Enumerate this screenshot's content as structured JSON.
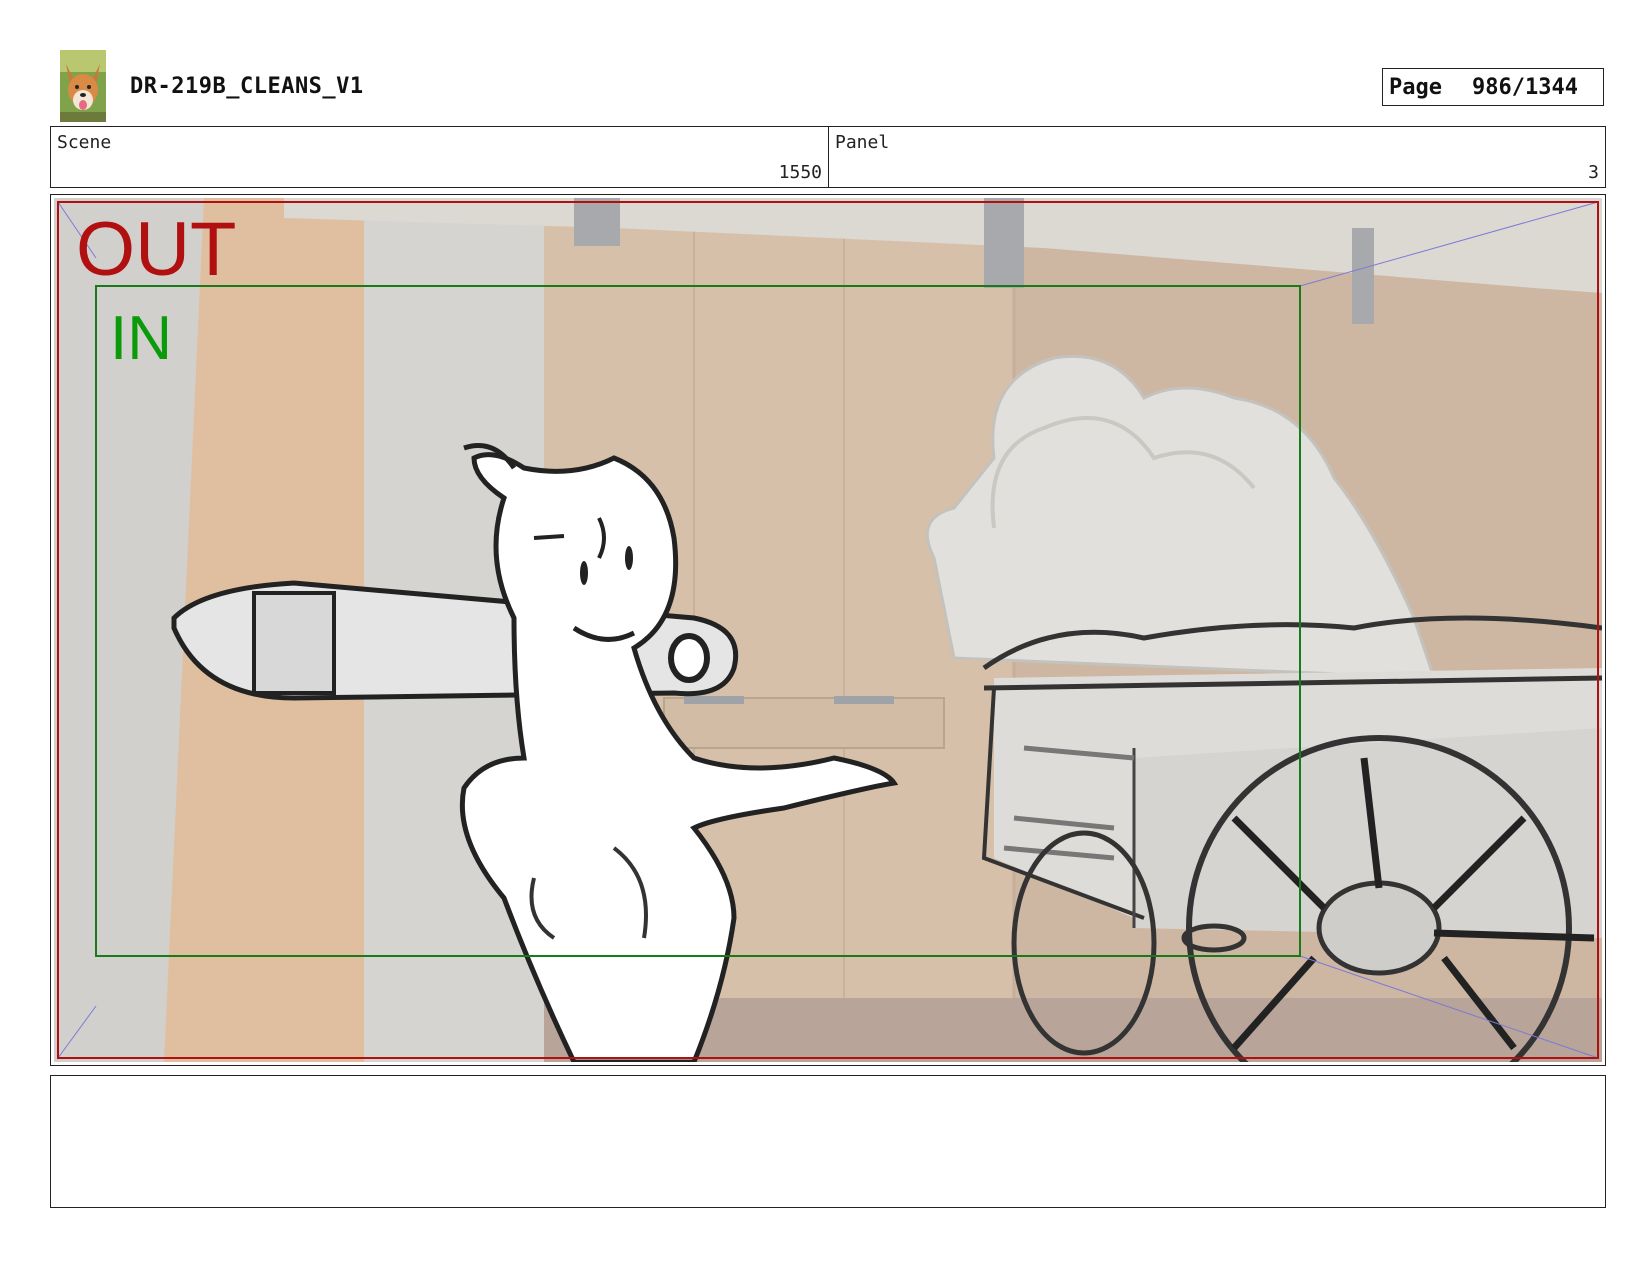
{
  "header": {
    "title": "DR-219B_CLEANS_V1",
    "page_label": "Page",
    "page_value": "986/1344"
  },
  "info": {
    "scene_label": "Scene",
    "scene_value": "1550",
    "panel_label": "Panel",
    "panel_value": "3"
  },
  "frame": {
    "out_label": "OUT",
    "in_label": "IN",
    "out_color": "#b01010",
    "in_color": "#0a9a0a"
  },
  "icons": {
    "logo": "dog-logo-icon"
  },
  "notes": {
    "text": ""
  }
}
